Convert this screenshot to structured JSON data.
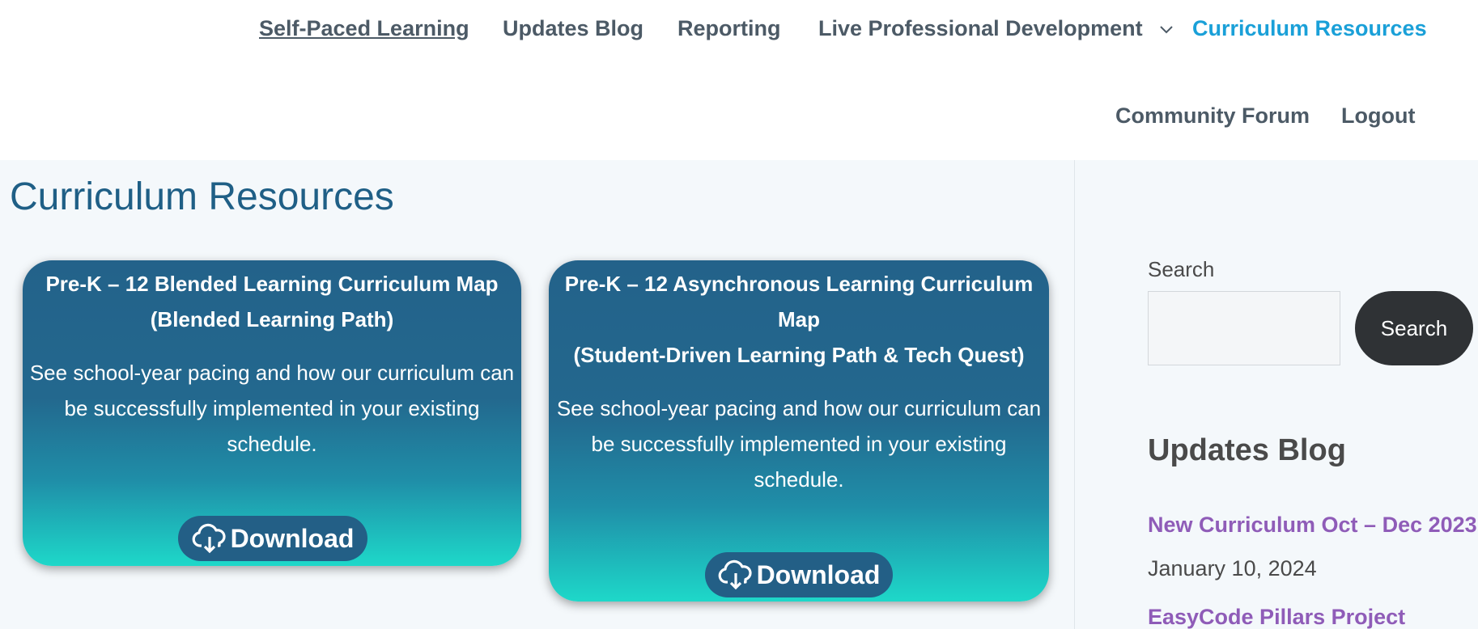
{
  "nav": {
    "self_paced": "Self-Paced Learning",
    "updates_blog": "Updates Blog",
    "reporting": "Reporting",
    "live_pd": "Live Professional Development",
    "curriculum": "Curriculum Resources",
    "community": "Community Forum",
    "logout": "Logout",
    "active_color": "#1aa0d8"
  },
  "page": {
    "title": "Curriculum Resources"
  },
  "cards": [
    {
      "title_line1": "Pre-K – 12 Blended Learning Curriculum Map",
      "title_line2": "(Blended Learning Path)",
      "desc_line1": "See school-year pacing and how our curriculum can",
      "desc_line2": "be successfully implemented in your existing",
      "desc_line3": "schedule.",
      "button": "Download",
      "icon": "cloud-download-icon"
    },
    {
      "title_line1": "Pre-K – 12 Asynchronous Learning Curriculum",
      "title_line2": "Map",
      "title_line3": "(Student-Driven Learning Path & Tech Quest)",
      "desc_line1": "See school-year pacing and how our curriculum can",
      "desc_line2": "be successfully implemented in your existing",
      "desc_line3": "schedule.",
      "button": "Download",
      "icon": "cloud-download-icon"
    }
  ],
  "sidebar": {
    "search_label": "Search",
    "search_value": "",
    "search_button": "Search",
    "heading": "Updates Blog",
    "posts": [
      {
        "title": "New Curriculum Oct – Dec 2023",
        "date": "January 10, 2024"
      },
      {
        "title": "EasyCode Pillars Project"
      }
    ],
    "link_color": "#8f5cb8"
  }
}
